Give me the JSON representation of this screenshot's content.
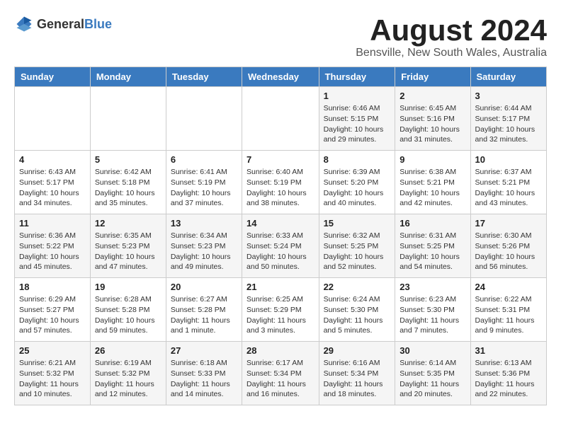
{
  "logo": {
    "text_general": "General",
    "text_blue": "Blue"
  },
  "title": {
    "month_year": "August 2024",
    "location": "Bensville, New South Wales, Australia"
  },
  "headers": [
    "Sunday",
    "Monday",
    "Tuesday",
    "Wednesday",
    "Thursday",
    "Friday",
    "Saturday"
  ],
  "weeks": [
    [
      {
        "day": "",
        "info": ""
      },
      {
        "day": "",
        "info": ""
      },
      {
        "day": "",
        "info": ""
      },
      {
        "day": "",
        "info": ""
      },
      {
        "day": "1",
        "info": "Sunrise: 6:46 AM\nSunset: 5:15 PM\nDaylight: 10 hours\nand 29 minutes."
      },
      {
        "day": "2",
        "info": "Sunrise: 6:45 AM\nSunset: 5:16 PM\nDaylight: 10 hours\nand 31 minutes."
      },
      {
        "day": "3",
        "info": "Sunrise: 6:44 AM\nSunset: 5:17 PM\nDaylight: 10 hours\nand 32 minutes."
      }
    ],
    [
      {
        "day": "4",
        "info": "Sunrise: 6:43 AM\nSunset: 5:17 PM\nDaylight: 10 hours\nand 34 minutes."
      },
      {
        "day": "5",
        "info": "Sunrise: 6:42 AM\nSunset: 5:18 PM\nDaylight: 10 hours\nand 35 minutes."
      },
      {
        "day": "6",
        "info": "Sunrise: 6:41 AM\nSunset: 5:19 PM\nDaylight: 10 hours\nand 37 minutes."
      },
      {
        "day": "7",
        "info": "Sunrise: 6:40 AM\nSunset: 5:19 PM\nDaylight: 10 hours\nand 38 minutes."
      },
      {
        "day": "8",
        "info": "Sunrise: 6:39 AM\nSunset: 5:20 PM\nDaylight: 10 hours\nand 40 minutes."
      },
      {
        "day": "9",
        "info": "Sunrise: 6:38 AM\nSunset: 5:21 PM\nDaylight: 10 hours\nand 42 minutes."
      },
      {
        "day": "10",
        "info": "Sunrise: 6:37 AM\nSunset: 5:21 PM\nDaylight: 10 hours\nand 43 minutes."
      }
    ],
    [
      {
        "day": "11",
        "info": "Sunrise: 6:36 AM\nSunset: 5:22 PM\nDaylight: 10 hours\nand 45 minutes."
      },
      {
        "day": "12",
        "info": "Sunrise: 6:35 AM\nSunset: 5:23 PM\nDaylight: 10 hours\nand 47 minutes."
      },
      {
        "day": "13",
        "info": "Sunrise: 6:34 AM\nSunset: 5:23 PM\nDaylight: 10 hours\nand 49 minutes."
      },
      {
        "day": "14",
        "info": "Sunrise: 6:33 AM\nSunset: 5:24 PM\nDaylight: 10 hours\nand 50 minutes."
      },
      {
        "day": "15",
        "info": "Sunrise: 6:32 AM\nSunset: 5:25 PM\nDaylight: 10 hours\nand 52 minutes."
      },
      {
        "day": "16",
        "info": "Sunrise: 6:31 AM\nSunset: 5:25 PM\nDaylight: 10 hours\nand 54 minutes."
      },
      {
        "day": "17",
        "info": "Sunrise: 6:30 AM\nSunset: 5:26 PM\nDaylight: 10 hours\nand 56 minutes."
      }
    ],
    [
      {
        "day": "18",
        "info": "Sunrise: 6:29 AM\nSunset: 5:27 PM\nDaylight: 10 hours\nand 57 minutes."
      },
      {
        "day": "19",
        "info": "Sunrise: 6:28 AM\nSunset: 5:28 PM\nDaylight: 10 hours\nand 59 minutes."
      },
      {
        "day": "20",
        "info": "Sunrise: 6:27 AM\nSunset: 5:28 PM\nDaylight: 11 hours\nand 1 minute."
      },
      {
        "day": "21",
        "info": "Sunrise: 6:25 AM\nSunset: 5:29 PM\nDaylight: 11 hours\nand 3 minutes."
      },
      {
        "day": "22",
        "info": "Sunrise: 6:24 AM\nSunset: 5:30 PM\nDaylight: 11 hours\nand 5 minutes."
      },
      {
        "day": "23",
        "info": "Sunrise: 6:23 AM\nSunset: 5:30 PM\nDaylight: 11 hours\nand 7 minutes."
      },
      {
        "day": "24",
        "info": "Sunrise: 6:22 AM\nSunset: 5:31 PM\nDaylight: 11 hours\nand 9 minutes."
      }
    ],
    [
      {
        "day": "25",
        "info": "Sunrise: 6:21 AM\nSunset: 5:32 PM\nDaylight: 11 hours\nand 10 minutes."
      },
      {
        "day": "26",
        "info": "Sunrise: 6:19 AM\nSunset: 5:32 PM\nDaylight: 11 hours\nand 12 minutes."
      },
      {
        "day": "27",
        "info": "Sunrise: 6:18 AM\nSunset: 5:33 PM\nDaylight: 11 hours\nand 14 minutes."
      },
      {
        "day": "28",
        "info": "Sunrise: 6:17 AM\nSunset: 5:34 PM\nDaylight: 11 hours\nand 16 minutes."
      },
      {
        "day": "29",
        "info": "Sunrise: 6:16 AM\nSunset: 5:34 PM\nDaylight: 11 hours\nand 18 minutes."
      },
      {
        "day": "30",
        "info": "Sunrise: 6:14 AM\nSunset: 5:35 PM\nDaylight: 11 hours\nand 20 minutes."
      },
      {
        "day": "31",
        "info": "Sunrise: 6:13 AM\nSunset: 5:36 PM\nDaylight: 11 hours\nand 22 minutes."
      }
    ]
  ]
}
